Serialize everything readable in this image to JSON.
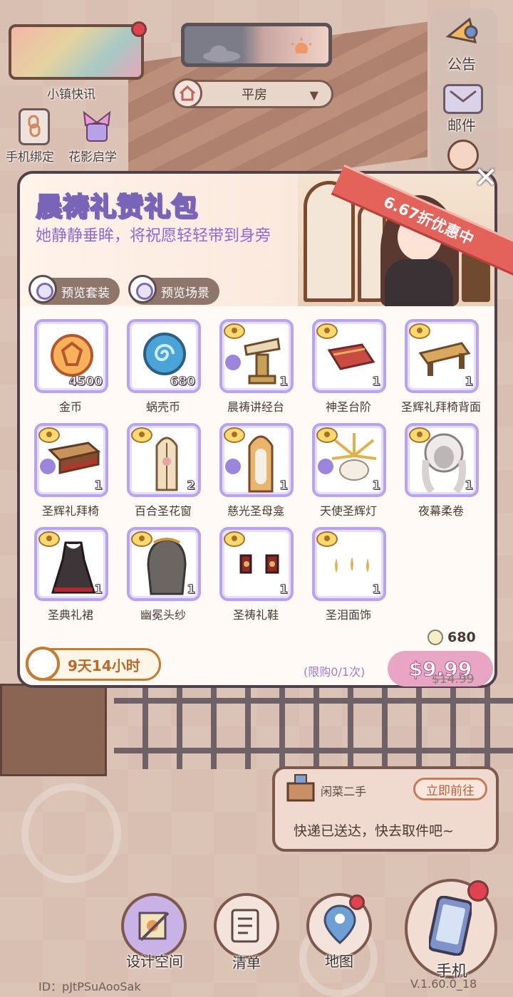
{
  "top_left": {
    "news_label": "小镇快讯",
    "bind_phone_label": "手机绑定",
    "flower_label": "花影启学"
  },
  "top_center": {
    "house_name": "平房"
  },
  "right_menu": {
    "notice_label": "公告",
    "mail_label": "邮件"
  },
  "popup": {
    "title": "晨祷礼赞礼包",
    "subtitle": "她静静垂眸，将祝愿轻轻带到身旁",
    "discount": "6.67折优惠中",
    "preview_outfit": "预览套装",
    "preview_scene": "预览场景",
    "items": [
      {
        "name": "金币",
        "count": "4500",
        "icon": "gold-coin"
      },
      {
        "name": "蜗壳币",
        "count": "680",
        "icon": "snail-coin"
      },
      {
        "name": "晨祷讲经台",
        "count": "1",
        "icon": "lectern"
      },
      {
        "name": "神圣台阶",
        "count": "1",
        "icon": "steps"
      },
      {
        "name": "圣辉礼拜椅背面",
        "count": "1",
        "icon": "pew-back"
      },
      {
        "name": "圣辉礼拜椅",
        "count": "1",
        "icon": "pew"
      },
      {
        "name": "百合圣花窗",
        "count": "2",
        "icon": "window"
      },
      {
        "name": "慈光圣母龛",
        "count": "1",
        "icon": "shrine"
      },
      {
        "name": "天使圣辉灯",
        "count": "1",
        "icon": "angel-lamp"
      },
      {
        "name": "夜幕柔卷",
        "count": "1",
        "icon": "hair"
      },
      {
        "name": "圣典礼裙",
        "count": "1",
        "icon": "dress"
      },
      {
        "name": "幽冕头纱",
        "count": "1",
        "icon": "veil"
      },
      {
        "name": "圣祷礼鞋",
        "count": "1",
        "icon": "shoes"
      },
      {
        "name": "圣泪面饰",
        "count": "1",
        "icon": "face-deco"
      }
    ],
    "bonus_value": "680",
    "timer": "9天14小时",
    "limit": "(限购0/1次)",
    "price": "$9.99",
    "old_price": "$14.99"
  },
  "notice": {
    "tag": "闲菜二手",
    "go_label": "立即前往",
    "message": "快递已送达，快去取件吧~"
  },
  "bottom_nav": {
    "design_label": "设计空间",
    "list_label": "清单",
    "map_label": "地图",
    "phone_label": "手机"
  },
  "footer": {
    "id": "ID：pJtPSuAooSak",
    "version": "V.1.60.0_18"
  },
  "colors": {
    "accent_purple": "#8c6ad0",
    "price_pink": "#e8a6c4",
    "discount_red": "#e3625a",
    "timer_orange": "#c47b34"
  }
}
